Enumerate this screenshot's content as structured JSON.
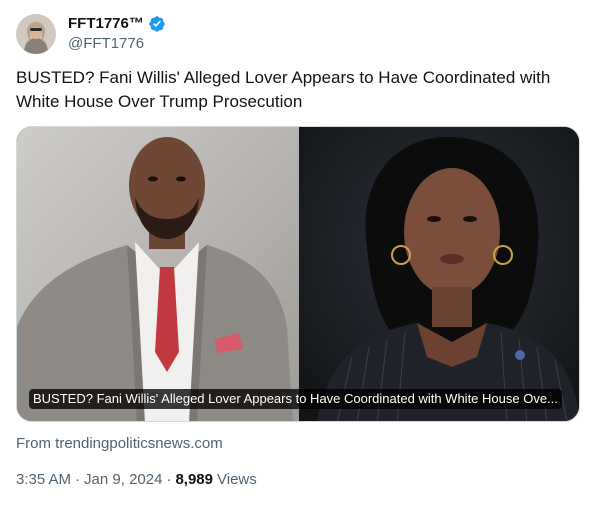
{
  "author": {
    "display_name": "FFT1776™",
    "handle": "@FFT1776",
    "verified_icon": "verified-badge-icon",
    "verified_color": "#1d9bf0"
  },
  "tweet": {
    "text": "BUSTED? Fani Willis' Alleged Lover Appears to Have Coordinated with White House Over Trump Prosecution"
  },
  "link_card": {
    "caption": "BUSTED? Fani Willis' Alleged Lover Appears to Have Coordinated with White House Ove...",
    "source": "From trendingpoliticsnews.com"
  },
  "meta": {
    "time": "3:35 AM",
    "date": "Jan 9, 2024",
    "separator": "·",
    "views_count": "8,989",
    "views_label": "Views"
  },
  "colors": {
    "text": "#0f1419",
    "secondary": "#536471",
    "border": "#cfd9de"
  }
}
